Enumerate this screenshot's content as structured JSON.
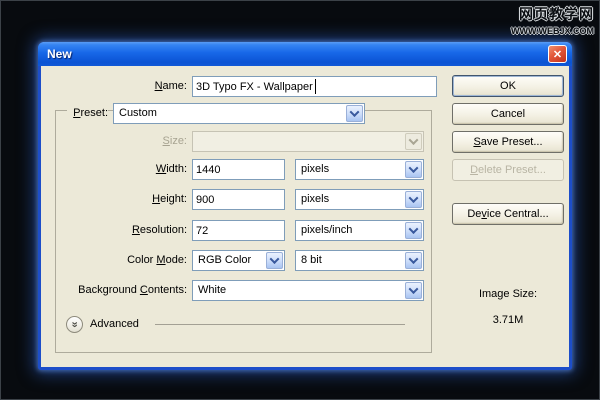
{
  "watermark": {
    "line1": "网页教学网",
    "line2": "WWW.WEBJX.COM"
  },
  "dialog": {
    "title": "New",
    "icons": {
      "close": "✕",
      "advanced_chevron": "»"
    },
    "fields": {
      "name": {
        "label": {
          "pre": "",
          "key": "N",
          "post": "ame:"
        },
        "value": "3D Typo FX - Wallpaper"
      },
      "preset": {
        "label": {
          "pre": "",
          "key": "P",
          "post": "reset:"
        },
        "value": "Custom"
      },
      "size": {
        "label": {
          "pre": "",
          "key": "S",
          "post": "ize:"
        },
        "value": ""
      },
      "width": {
        "label": {
          "pre": "",
          "key": "W",
          "post": "idth:"
        },
        "value": "1440",
        "unit": "pixels"
      },
      "height": {
        "label": {
          "pre": "",
          "key": "H",
          "post": "eight:"
        },
        "value": "900",
        "unit": "pixels"
      },
      "resolution": {
        "label": {
          "pre": "",
          "key": "R",
          "post": "esolution:"
        },
        "value": "72",
        "unit": "pixels/inch"
      },
      "color_mode": {
        "label": {
          "pre": "Color ",
          "key": "M",
          "post": "ode:"
        },
        "value": "RGB Color",
        "depth": "8 bit"
      },
      "background_contents": {
        "label": {
          "pre": "Background ",
          "key": "C",
          "post": "ontents:"
        },
        "value": "White"
      }
    },
    "advanced": {
      "label": "Advanced"
    },
    "buttons": {
      "ok": {
        "pre": "",
        "key": "",
        "post": "OK"
      },
      "cancel": {
        "pre": "",
        "key": "",
        "post": "Cancel"
      },
      "save_preset": {
        "pre": "",
        "key": "S",
        "post": "ave Preset..."
      },
      "delete_preset": {
        "pre": "",
        "key": "D",
        "post": "elete Preset..."
      },
      "device_central": {
        "pre": "De",
        "key": "v",
        "post": "ice Central..."
      }
    },
    "image_size": {
      "label": "Image Size:",
      "value": "3.71M"
    }
  },
  "colors": {
    "frame_blue": "#1d4ec9",
    "dialog_face": "#ece9d8",
    "field_border": "#7f9db9",
    "titlebar_blue": "#1767e8",
    "close_red": "#d14427"
  }
}
